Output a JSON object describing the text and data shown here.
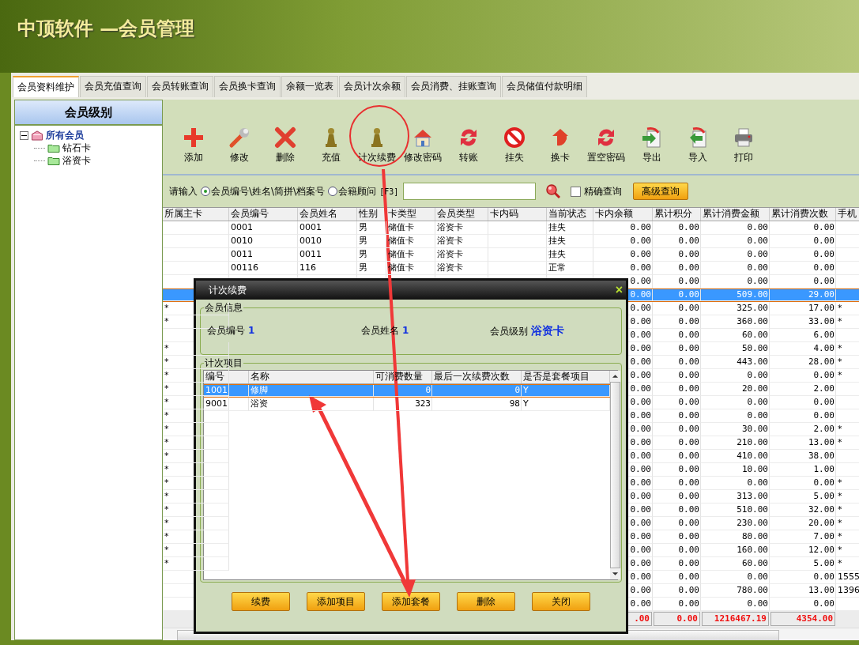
{
  "header": {
    "title": "中顶软件 —会员管理"
  },
  "tabs": [
    {
      "label": "会员资料维护",
      "selected": true
    },
    {
      "label": "会员充值查询",
      "selected": false
    },
    {
      "label": "会员转账查询",
      "selected": false
    },
    {
      "label": "会员换卡查询",
      "selected": false
    },
    {
      "label": "余额一览表",
      "selected": false
    },
    {
      "label": "会员计次余额",
      "selected": false
    },
    {
      "label": "会员消费、挂账查询",
      "selected": false
    },
    {
      "label": "会员储值付款明细",
      "selected": false
    }
  ],
  "sidebar": {
    "title": "会员级别",
    "tree": [
      {
        "label": "所有会员",
        "expanded": true,
        "children": [
          {
            "label": "钻石卡"
          },
          {
            "label": "浴资卡"
          }
        ]
      }
    ]
  },
  "toolbar": [
    {
      "label": "添加",
      "kind": "add"
    },
    {
      "label": "修改",
      "kind": "edit"
    },
    {
      "label": "删除",
      "kind": "delete"
    },
    {
      "label": "充值",
      "kind": "pawn"
    },
    {
      "label": "计次续费",
      "kind": "pawn"
    },
    {
      "label": "修改密码",
      "kind": "house"
    },
    {
      "label": "转账",
      "kind": "cycle"
    },
    {
      "label": "挂失",
      "kind": "ban"
    },
    {
      "label": "换卡",
      "kind": "arrow"
    },
    {
      "label": "置空密码",
      "kind": "cycle"
    },
    {
      "label": "导出",
      "kind": "export"
    },
    {
      "label": "导入",
      "kind": "import"
    },
    {
      "label": "打印",
      "kind": "print"
    }
  ],
  "search": {
    "prompt": "请输入",
    "options": [
      {
        "label": "会员编号\\姓名\\简拼\\档案号",
        "selected": true
      },
      {
        "label": "会籍顾问",
        "selected": false
      }
    ],
    "hotkey": "[F3]",
    "exact": {
      "label": "精确查询",
      "checked": false
    },
    "advanced": "高级查询"
  },
  "table": {
    "columns": [
      "所属主卡",
      "会员编号",
      "会员姓名",
      "性别",
      "卡类型",
      "会员类型",
      "卡内码",
      "当前状态",
      "卡内余额",
      "累计积分",
      "累计消费金额",
      "累计消费次数",
      "手机"
    ],
    "rows": [
      {
        "selected": false,
        "member_no": "0001",
        "name": "0001",
        "gender": "男",
        "card_type": "储值卡",
        "member_type": "浴资卡",
        "status": "挂失",
        "balance": "0.00",
        "points": "0.00",
        "amount": "0.00",
        "count": "0.00"
      },
      {
        "selected": false,
        "member_no": "0010",
        "name": "0010",
        "gender": "男",
        "card_type": "储值卡",
        "member_type": "浴资卡",
        "status": "挂失",
        "balance": "0.00",
        "points": "0.00",
        "amount": "0.00",
        "count": "0.00"
      },
      {
        "selected": false,
        "member_no": "0011",
        "name": "0011",
        "gender": "男",
        "card_type": "储值卡",
        "member_type": "浴资卡",
        "status": "挂失",
        "balance": "0.00",
        "points": "0.00",
        "amount": "0.00",
        "count": "0.00"
      },
      {
        "selected": false,
        "member_no": "00116",
        "name": "116",
        "gender": "男",
        "card_type": "储值卡",
        "member_type": "浴资卡",
        "status": "正常",
        "balance": "0.00",
        "points": "0.00",
        "amount": "0.00",
        "count": "0.00"
      },
      {
        "selected": false,
        "balance": "0.00",
        "points": "0.00",
        "amount": "0.00",
        "count": "0.00"
      },
      {
        "selected": true,
        "balance": "0.00",
        "points": "0.00",
        "amount": "509.00",
        "count": "29.00"
      },
      {
        "selected": false,
        "main": "*",
        "balance": "0.00",
        "points": "0.00",
        "amount": "325.00",
        "count": "17.00",
        "phone": "*"
      },
      {
        "selected": false,
        "main": "*",
        "balance": "0.00",
        "points": "0.00",
        "amount": "360.00",
        "count": "33.00",
        "phone": "*"
      },
      {
        "selected": false,
        "balance": "0.00",
        "points": "0.00",
        "amount": "60.00",
        "count": "6.00"
      },
      {
        "selected": false,
        "main": "*",
        "balance": "0.00",
        "points": "0.00",
        "amount": "50.00",
        "count": "4.00",
        "phone": "*"
      },
      {
        "selected": false,
        "main": "*",
        "balance": "0.00",
        "points": "0.00",
        "amount": "443.00",
        "count": "28.00",
        "phone": "*"
      },
      {
        "selected": false,
        "main": "*",
        "balance": "0.00",
        "points": "0.00",
        "amount": "0.00",
        "count": "0.00",
        "phone": "*"
      },
      {
        "selected": false,
        "main": "*",
        "balance": "0.00",
        "points": "0.00",
        "amount": "20.00",
        "count": "2.00"
      },
      {
        "selected": false,
        "main": "*",
        "balance": "0.00",
        "points": "0.00",
        "amount": "0.00",
        "count": "0.00"
      },
      {
        "selected": false,
        "main": "*",
        "balance": "0.00",
        "points": "0.00",
        "amount": "0.00",
        "count": "0.00"
      },
      {
        "selected": false,
        "main": "*",
        "balance": "0.00",
        "points": "0.00",
        "amount": "30.00",
        "count": "2.00",
        "phone": "*"
      },
      {
        "selected": false,
        "main": "*",
        "balance": "0.00",
        "points": "0.00",
        "amount": "210.00",
        "count": "13.00",
        "phone": "*"
      },
      {
        "selected": false,
        "main": "*",
        "balance": "0.00",
        "points": "0.00",
        "amount": "410.00",
        "count": "38.00"
      },
      {
        "selected": false,
        "main": "*",
        "balance": "0.00",
        "points": "0.00",
        "amount": "10.00",
        "count": "1.00"
      },
      {
        "selected": false,
        "main": "*",
        "balance": "0.00",
        "points": "0.00",
        "amount": "0.00",
        "count": "0.00",
        "phone": "*"
      },
      {
        "selected": false,
        "main": "*",
        "balance": "0.00",
        "points": "0.00",
        "amount": "313.00",
        "count": "5.00",
        "phone": "*"
      },
      {
        "selected": false,
        "main": "*",
        "balance": "0.00",
        "points": "0.00",
        "amount": "510.00",
        "count": "32.00",
        "phone": "*"
      },
      {
        "selected": false,
        "main": "*",
        "balance": "0.00",
        "points": "0.00",
        "amount": "230.00",
        "count": "20.00",
        "phone": "*"
      },
      {
        "selected": false,
        "main": "*",
        "balance": "0.00",
        "points": "0.00",
        "amount": "80.00",
        "count": "7.00",
        "phone": "*"
      },
      {
        "selected": false,
        "main": "*",
        "balance": "0.00",
        "points": "0.00",
        "amount": "160.00",
        "count": "12.00",
        "phone": "*"
      },
      {
        "selected": false,
        "main": "*",
        "balance": "0.00",
        "points": "0.00",
        "amount": "60.00",
        "count": "5.00",
        "phone": "*"
      },
      {
        "selected": false,
        "balance": "0.00",
        "points": "0.00",
        "amount": "0.00",
        "count": "0.00",
        "phone": "1555"
      },
      {
        "selected": false,
        "balance": "0.00",
        "points": "0.00",
        "amount": "780.00",
        "count": "13.00",
        "phone": "1396"
      },
      {
        "selected": false,
        "balance": "0.00",
        "points": "0.00",
        "amount": "0.00",
        "count": "0.00"
      }
    ],
    "totals": [
      ".00",
      "0.00",
      "1216467.19",
      "4354.00"
    ]
  },
  "dialog": {
    "title": "计次续费",
    "close": "×",
    "info_title": "会员信息",
    "info": [
      {
        "label": "会员编号",
        "value": "1"
      },
      {
        "label": "会员姓名",
        "value": "1"
      },
      {
        "label": "会员级别",
        "value": "浴资卡"
      }
    ],
    "items_title": "计次项目",
    "columns": [
      "编号",
      "名称",
      "可消费数量",
      "最后一次续费次数",
      "是否是套餐项目"
    ],
    "rows": [
      {
        "selected": true,
        "cells": [
          "1001",
          "修脚",
          "0",
          "0",
          "Y"
        ]
      },
      {
        "selected": false,
        "cells": [
          "9001",
          "浴资",
          "323",
          "98",
          "Y"
        ]
      }
    ],
    "buttons": [
      "续费",
      "添加项目",
      "添加套餐",
      "删除",
      "关闭"
    ]
  }
}
